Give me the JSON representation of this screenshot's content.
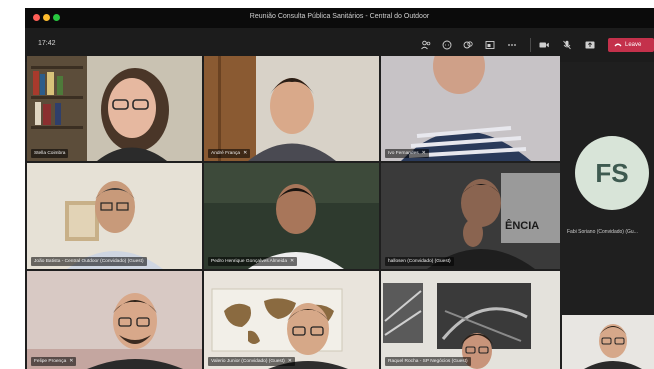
{
  "window": {
    "title": "Reunião Consulta Pública Sanitários - Central do Outdoor"
  },
  "toolbar": {
    "time": "17:42",
    "icons": [
      "participants-icon",
      "chat-icon",
      "reactions-icon",
      "rooms-icon",
      "more-icon",
      "camera-icon",
      "mic-off-icon",
      "share-icon"
    ],
    "leave_label": "Leave",
    "leave_color": "#c4314b"
  },
  "participants": [
    {
      "name": "Stella Coimbra"
    },
    {
      "name": "André França"
    },
    {
      "name": "Ivo Fernandes"
    },
    {
      "name": "João Batista - Central Outdoor (Convidado) (Guest)"
    },
    {
      "name": "Pedro Henrique Gonçalves Almeida"
    },
    {
      "name": "hallosen (Convidado) (Guest)"
    },
    {
      "name": "Felipe Proença"
    },
    {
      "name": "Valerio Junior (Convidado) (Guest)"
    },
    {
      "name": "Raquel Rocha - SP Negócios (Guest)"
    }
  ],
  "side_panel": {
    "avatar_initials": "FS",
    "avatar_color": "#d8e4d8",
    "name": "Fabi Soriano (Convidado) (Gu..."
  },
  "background_sign_text": "ÊNCIA"
}
